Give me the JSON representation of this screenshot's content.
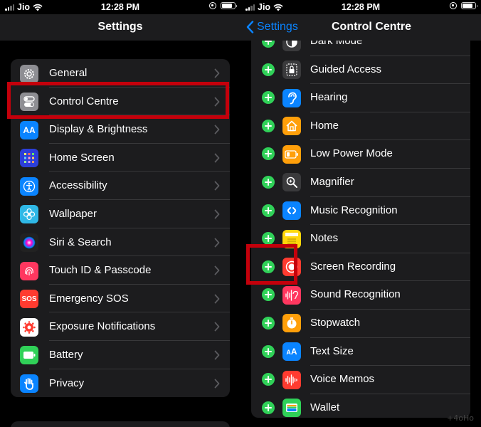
{
  "status_bar": {
    "carrier": "Jio",
    "time": "12:28 PM"
  },
  "left": {
    "title": "Settings",
    "items": [
      {
        "label": "General",
        "icon": "gear-icon",
        "color": "#8e8e93"
      },
      {
        "label": "Control Centre",
        "icon": "toggles-icon",
        "color": "#8e8e93"
      },
      {
        "label": "Display & Brightness",
        "icon": "aa-icon",
        "color": "#0a84ff"
      },
      {
        "label": "Home Screen",
        "icon": "home-grid-icon",
        "color": "#2c3fd9"
      },
      {
        "label": "Accessibility",
        "icon": "accessibility-icon",
        "color": "#0a84ff"
      },
      {
        "label": "Wallpaper",
        "icon": "flower-icon",
        "color": "#2fb8e6"
      },
      {
        "label": "Siri & Search",
        "icon": "siri-icon",
        "color": "#222"
      },
      {
        "label": "Touch ID & Passcode",
        "icon": "fingerprint-icon",
        "color": "#ff375f"
      },
      {
        "label": "Emergency SOS",
        "icon": "sos-icon",
        "color": "#ff3b30",
        "text": "SOS"
      },
      {
        "label": "Exposure Notifications",
        "icon": "exposure-icon",
        "color": "#ffffff"
      },
      {
        "label": "Battery",
        "icon": "battery-icon",
        "color": "#30d158"
      },
      {
        "label": "Privacy",
        "icon": "hand-icon",
        "color": "#0a84ff"
      }
    ]
  },
  "right": {
    "back_label": "Settings",
    "title": "Control Centre",
    "items": [
      {
        "label": "Dark Mode",
        "icon": "dark-mode-icon",
        "color": "#3a3a3c"
      },
      {
        "label": "Guided Access",
        "icon": "lock-icon",
        "color": "#3a3a3c"
      },
      {
        "label": "Hearing",
        "icon": "ear-icon",
        "color": "#0a84ff"
      },
      {
        "label": "Home",
        "icon": "house-icon",
        "color": "#ff9f0a"
      },
      {
        "label": "Low Power Mode",
        "icon": "low-battery-icon",
        "color": "#ff9f0a"
      },
      {
        "label": "Magnifier",
        "icon": "magnifier-icon",
        "color": "#3a3a3c"
      },
      {
        "label": "Music Recognition",
        "icon": "shazam-icon",
        "color": "#0a84ff"
      },
      {
        "label": "Notes",
        "icon": "notes-icon",
        "color": "#ffd60a"
      },
      {
        "label": "Screen Recording",
        "icon": "record-icon",
        "color": "#ff3b30"
      },
      {
        "label": "Sound Recognition",
        "icon": "waveform-ear-icon",
        "color": "#ff375f"
      },
      {
        "label": "Stopwatch",
        "icon": "stopwatch-icon",
        "color": "#ff9f0a"
      },
      {
        "label": "Text Size",
        "icon": "text-size-icon",
        "color": "#0a84ff",
        "text": "AA"
      },
      {
        "label": "Voice Memos",
        "icon": "waveform-icon",
        "color": "#ff3b30"
      },
      {
        "label": "Wallet",
        "icon": "wallet-icon",
        "color": "#30d158"
      }
    ]
  },
  "watermark": "+4oHo"
}
